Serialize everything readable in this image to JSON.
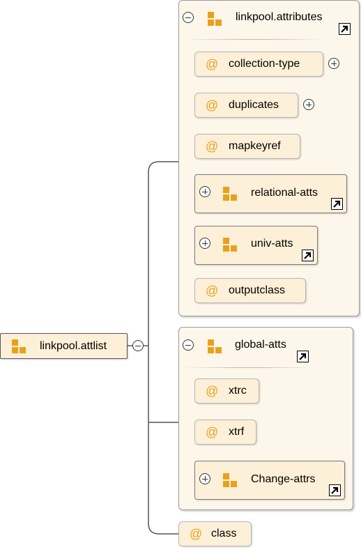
{
  "root": {
    "label": "linkpool.attlist",
    "icon": "attribute-group-icon"
  },
  "groups": {
    "linkpool_attributes": {
      "label": "linkpool.attributes",
      "items": {
        "collection_type": "collection-type",
        "duplicates": "duplicates",
        "mapkeyref": "mapkeyref",
        "relational_atts": "relational-atts",
        "univ_atts": "univ-atts",
        "outputclass": "outputclass"
      }
    },
    "global_atts": {
      "label": "global-atts",
      "items": {
        "xtrc": "xtrc",
        "xtrf": "xtrf",
        "change_attrs": "Change-attrs"
      }
    }
  },
  "class_attr": "class",
  "attribute_symbol": "@",
  "colors": {
    "node_fill": "#fdf0d8",
    "group_fill": "#fdf6ea",
    "icon_orange": "#e8a11c",
    "attr_symbol": "#e5a024"
  }
}
